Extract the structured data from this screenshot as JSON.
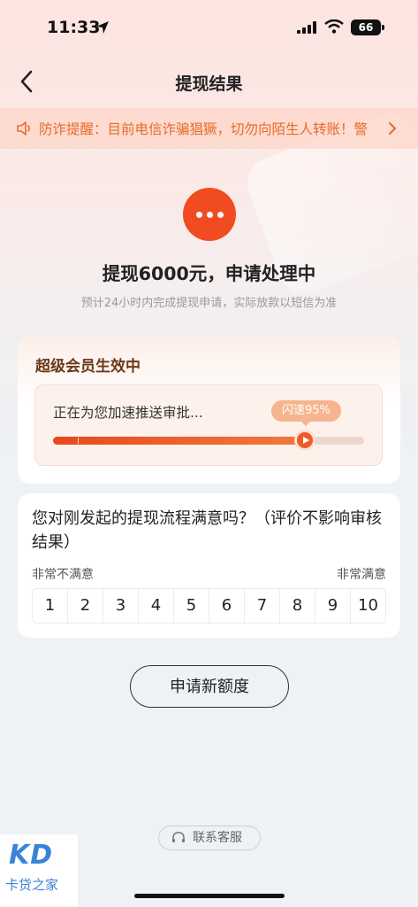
{
  "status_bar": {
    "time": "11:33",
    "battery": "66"
  },
  "nav": {
    "title": "提现结果"
  },
  "notice": {
    "text": "防诈提醒：目前电信诈骗猖獗，切勿向陌生人转账！警"
  },
  "result": {
    "headline": "提现6000元，申请处理中",
    "subline": "预计24小时内完成提现申请，实际放款以短信为准"
  },
  "vip": {
    "title": "超级会员生效中",
    "accel_text": "正在为您加速推送审批...",
    "speed_label": "闪速95%",
    "progress": 0.81
  },
  "survey": {
    "question": "您对刚发起的提现流程满意吗？（评价不影响审核结果）",
    "left_label": "非常不满意",
    "right_label": "非常满意",
    "scores": [
      "1",
      "2",
      "3",
      "4",
      "5",
      "6",
      "7",
      "8",
      "9",
      "10"
    ]
  },
  "apply_button": "申请新额度",
  "service_button": "联系客服",
  "watermark": {
    "logo": "KD",
    "text": "卡贷之家"
  },
  "colors": {
    "accent": "#f14b22",
    "notice_text": "#e86a2a",
    "vip_title": "#6b3a1a"
  },
  "icons": [
    "location-arrow-icon",
    "signal-icon",
    "wifi-icon",
    "battery-icon",
    "back-arrow-icon",
    "speaker-icon",
    "chevron-right-icon",
    "more-dots-icon",
    "play-icon",
    "headset-icon"
  ]
}
